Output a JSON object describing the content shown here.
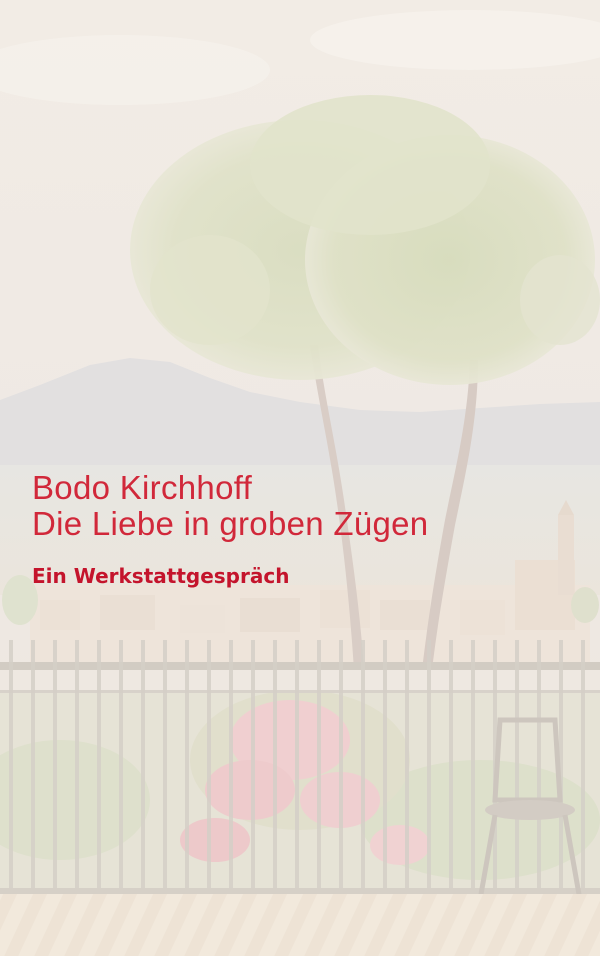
{
  "cover": {
    "author": "Bodo Kirchhoff",
    "title": "Die Liebe in groben Zügen",
    "subtitle": "Ein Werkstattgespräch",
    "colors": {
      "title_text": "#d1283a",
      "subtitle_text": "#c4142c",
      "background": "#f4efe6"
    }
  }
}
